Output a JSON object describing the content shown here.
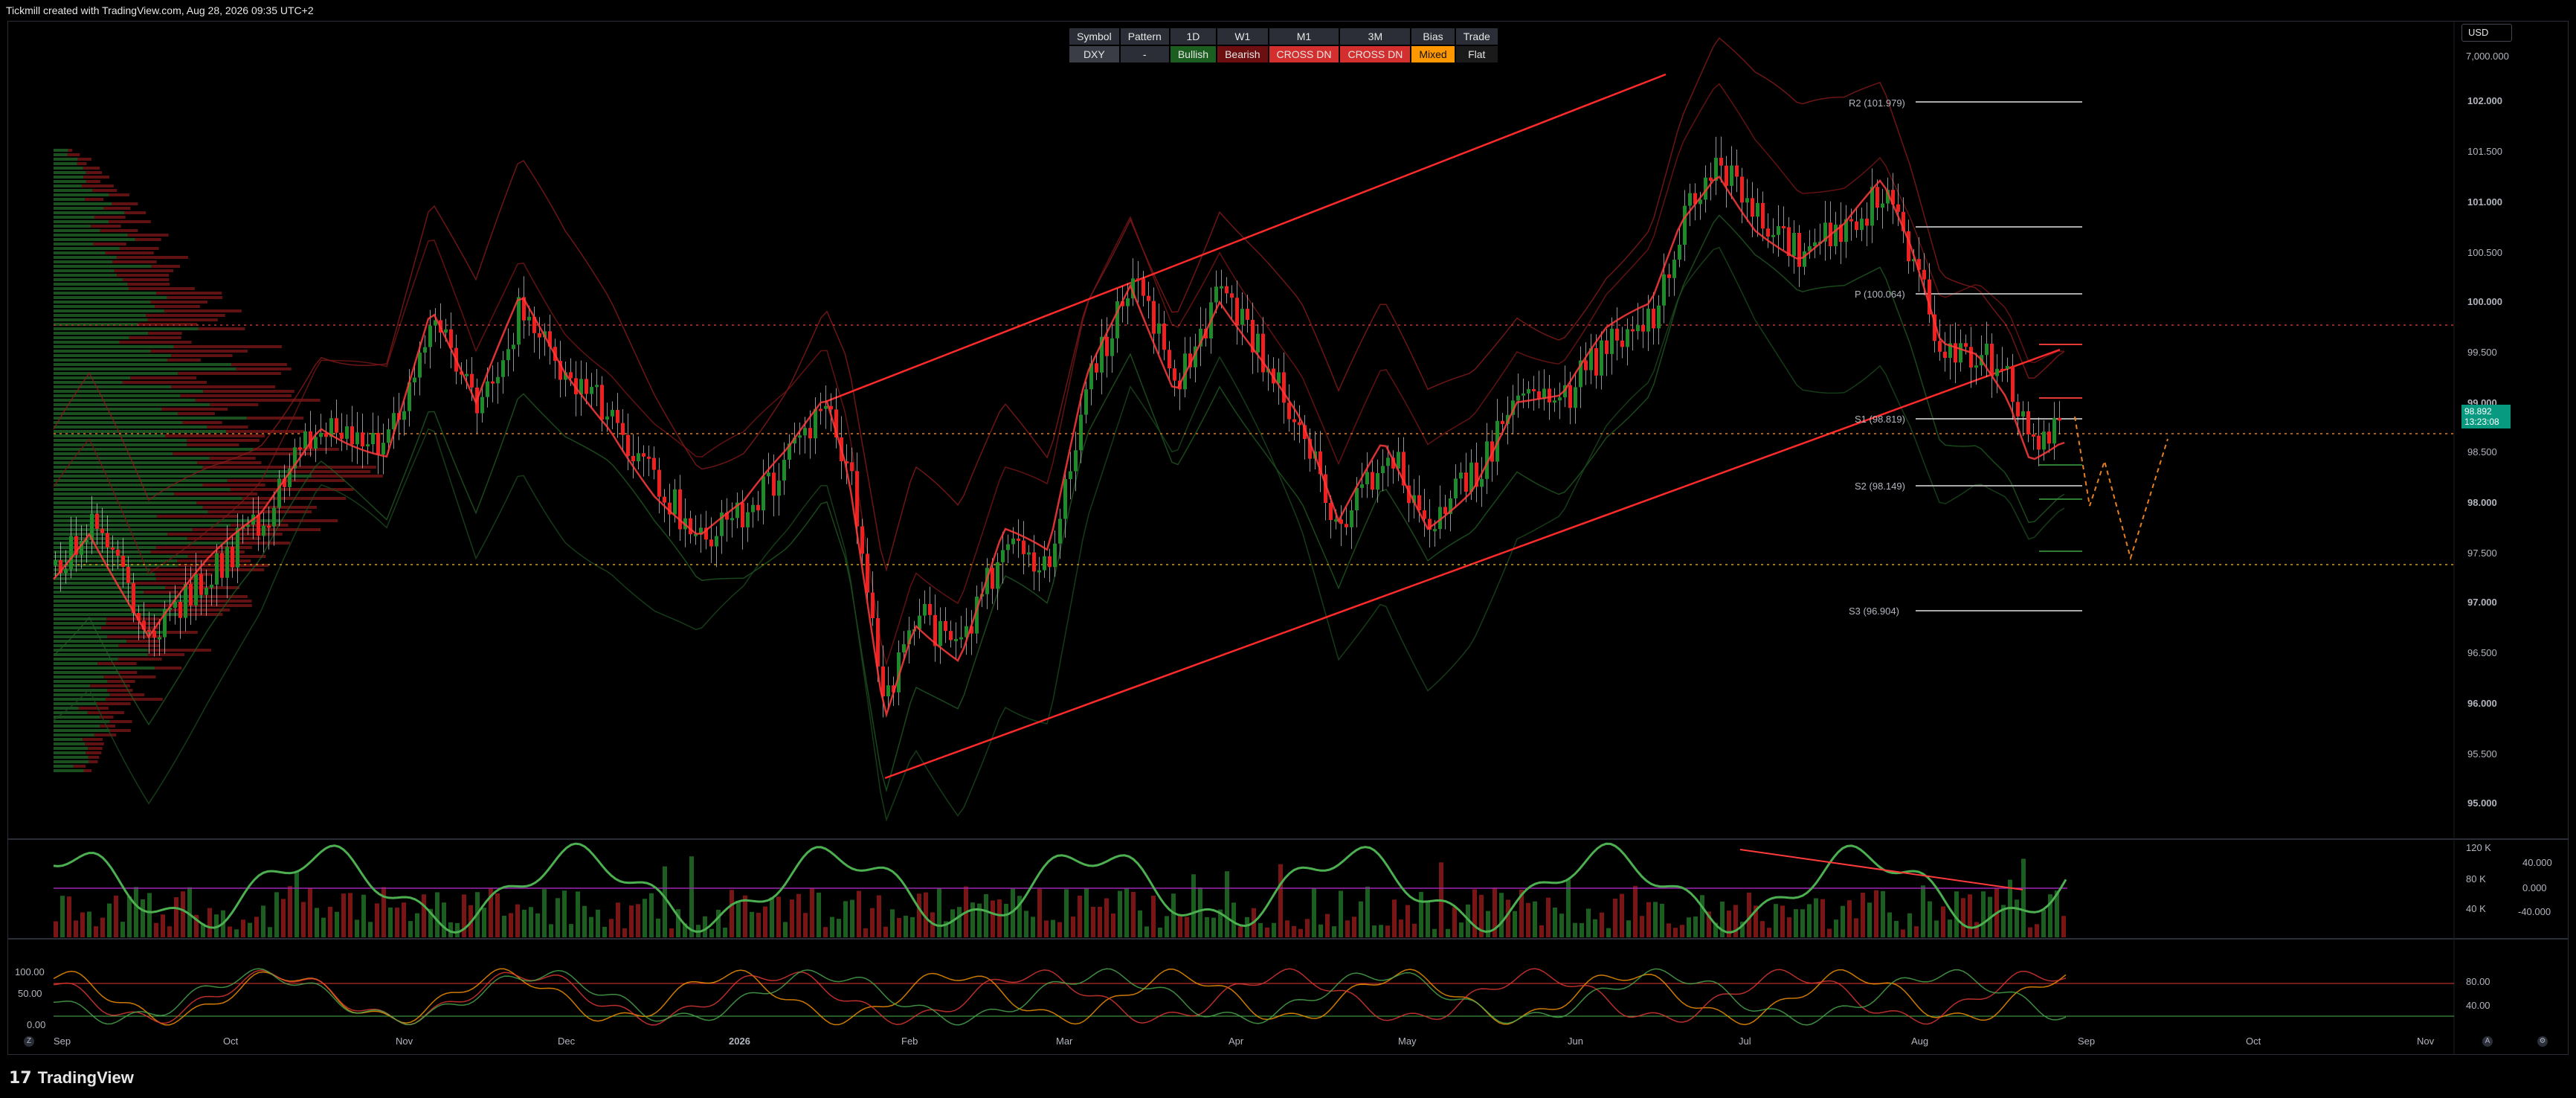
{
  "header": {
    "title": "Tickmill created with TradingView.com, Aug 28, 2026 09:35 UTC+2"
  },
  "status_table": {
    "headers": [
      "Symbol",
      "Pattern",
      "1D",
      "W1",
      "M1",
      "3M",
      "Bias",
      "Trade"
    ],
    "values": [
      "DXY",
      "-",
      "Bullish",
      "Bearish",
      "CROSS DN",
      "CROSS DN",
      "Mixed",
      "Flat"
    ]
  },
  "currency": "USD",
  "price_axis": [
    "7,000.000",
    "102.000",
    "101.500",
    "101.000",
    "100.500",
    "100.000",
    "99.500",
    "99.000",
    "98.500",
    "98.000",
    "97.500",
    "97.000",
    "96.500",
    "96.000",
    "95.500",
    "95.000"
  ],
  "price_tag": {
    "price": "98.892",
    "countdown": "13:23:08"
  },
  "pivot_labels": {
    "r2": "R2 (101.979)",
    "p": "P (100.064)",
    "s1": "S1 (98.819)",
    "s2": "S2 (98.149)",
    "s3": "S3 (96.904)"
  },
  "volume_axis": [
    "120 K",
    "80 K",
    "40 K"
  ],
  "oscillator_axis": [
    "40.000",
    "0.000",
    "-40.000"
  ],
  "stoch_left_axis": [
    "100.00",
    "50.00",
    "0.00"
  ],
  "stoch_right_axis": [
    "80.00",
    "40.00"
  ],
  "time_axis": [
    "Sep",
    "Oct",
    "Nov",
    "Dec",
    "2026",
    "Feb",
    "Mar",
    "Apr",
    "May",
    "Jun",
    "Jul",
    "Aug",
    "Sep",
    "Oct",
    "Nov"
  ],
  "footer": {
    "brand": "TradingView"
  },
  "colors": {
    "bull": "#26a69a",
    "bull_candle": "#1e8a2a",
    "bear": "#ef2020",
    "accent": "#089981",
    "mixed": "#ff9800"
  }
}
